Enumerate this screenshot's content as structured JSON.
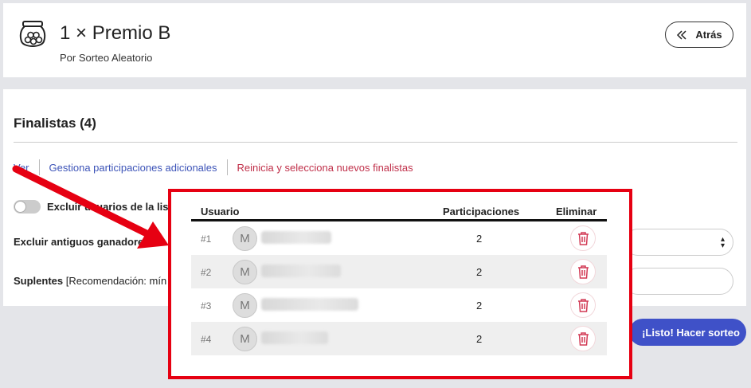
{
  "header": {
    "title": "1 × Premio B",
    "subtitle": "Por Sorteo Aleatorio",
    "back_label": "Atrás"
  },
  "finalists": {
    "title": "Finalistas (4)",
    "links": [
      "Ver",
      "Gestiona participaciones adicionales",
      "Reinicia y selecciona nuevos finalistas"
    ],
    "toggle_label": "Excluir usuarios de la lista",
    "exclude_winners_label": "Excluir antiguos ganadores",
    "substitutes_label": "Suplentes",
    "substitutes_hint": "[Recomendación: mín"
  },
  "table": {
    "headers": {
      "user": "Usuario",
      "entries": "Participaciones",
      "delete": "Eliminar"
    },
    "rows": [
      {
        "rank": "#1",
        "initial": "M",
        "entries": "2"
      },
      {
        "rank": "#2",
        "initial": "M",
        "entries": "2"
      },
      {
        "rank": "#3",
        "initial": "M",
        "entries": "2"
      },
      {
        "rank": "#4",
        "initial": "M",
        "entries": "2"
      }
    ]
  },
  "draw_button": "¡Listo! Hacer sorteo",
  "colors": {
    "accent": "#3f51c8",
    "link": "#3d54b8",
    "danger": "#c0304a",
    "highlight": "#e60012"
  }
}
